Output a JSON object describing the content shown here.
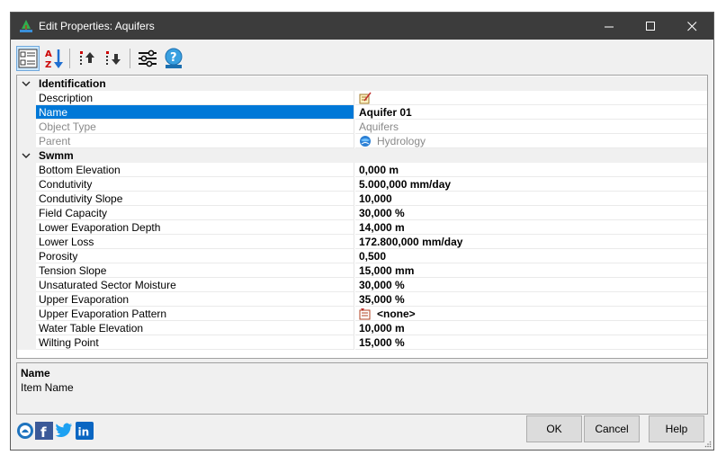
{
  "window": {
    "title": "Edit Properties: Aquifers",
    "controls": [
      "minimize-icon",
      "maximize-icon",
      "close-icon"
    ]
  },
  "toolbar": {
    "tools": [
      "categorized-view-icon",
      "alphabetical-sort-icon",
      "move-up-icon",
      "move-down-icon",
      "settings-sliders-icon",
      "help-icon"
    ],
    "active": "categorized-view-icon"
  },
  "grid": {
    "categories": [
      {
        "label": "Identification",
        "properties": [
          {
            "name": "Description",
            "value": "",
            "icon": "edit-note-icon",
            "readonly": false,
            "selected": false
          },
          {
            "name": "Name",
            "value": "Aquifer 01",
            "readonly": false,
            "selected": true
          },
          {
            "name": "Object Type",
            "value": "Aquifers",
            "readonly": true,
            "selected": false
          },
          {
            "name": "Parent",
            "value": "Hydrology",
            "icon": "hydrology-globe-icon",
            "readonly": true,
            "selected": false
          }
        ]
      },
      {
        "label": "Swmm",
        "properties": [
          {
            "name": "Bottom Elevation",
            "value": "0,000 m"
          },
          {
            "name": "Condutivity",
            "value": "5.000,000 mm/day"
          },
          {
            "name": "Condutivity Slope",
            "value": "10,000"
          },
          {
            "name": "Field Capacity",
            "value": "30,000 %"
          },
          {
            "name": "Lower Evaporation Depth",
            "value": "14,000 m"
          },
          {
            "name": "Lower Loss",
            "value": "172.800,000 mm/day"
          },
          {
            "name": "Porosity",
            "value": "0,500"
          },
          {
            "name": "Tension Slope",
            "value": "15,000 mm"
          },
          {
            "name": "Unsaturated Sector Moisture",
            "value": "30,000 %"
          },
          {
            "name": "Upper Evaporation",
            "value": "35,000 %"
          },
          {
            "name": "Upper Evaporation Pattern",
            "value": "<none>",
            "icon": "pattern-icon"
          },
          {
            "name": "Water Table Elevation",
            "value": "10,000 m"
          },
          {
            "name": "Wilting Point",
            "value": "15,000 %"
          }
        ]
      }
    ]
  },
  "help_panel": {
    "title": "Name",
    "description": "Item Name"
  },
  "footer": {
    "social": [
      "app-logo-icon",
      "facebook-icon",
      "twitter-icon",
      "linkedin-icon"
    ],
    "buttons": {
      "ok": "OK",
      "cancel": "Cancel",
      "help": "Help"
    }
  },
  "colors": {
    "titlebar": "#3c3c3c",
    "selection": "#0078d7",
    "facebook": "#3b5998",
    "twitter": "#1da1f2",
    "linkedin": "#0a66c2"
  }
}
